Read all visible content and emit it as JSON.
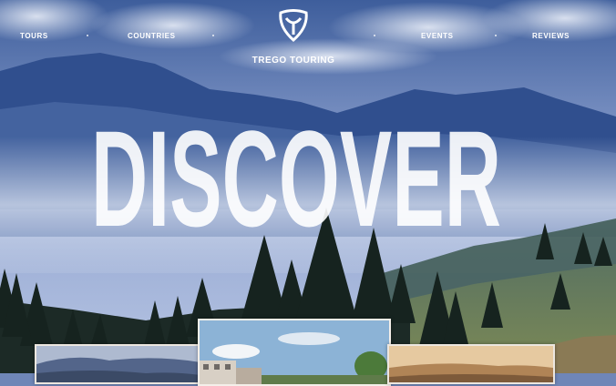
{
  "nav": {
    "links": [
      "TOURS",
      "COUNTRIES",
      "EVENTS",
      "REVIEWS"
    ]
  },
  "brand": {
    "name": "TREGO TOURING",
    "logo_icon": "trego-shield-logo-icon"
  },
  "hero": {
    "title": "DISCOVER"
  },
  "colors": {
    "sky_top": "#3e5e9c",
    "sky_bottom": "#b7c5e3",
    "mountains": "#304f8e",
    "haze": "#dde4f2",
    "forest": "#1c2a26",
    "meadow": "#6c7f56",
    "text": "#ffffff"
  }
}
